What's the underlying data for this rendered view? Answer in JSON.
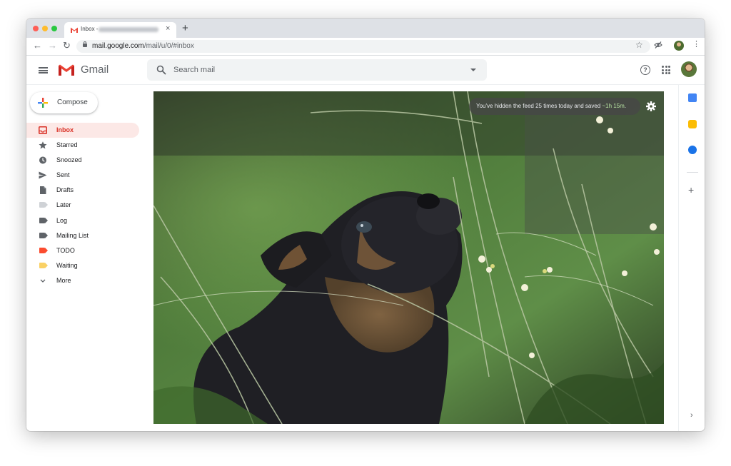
{
  "browser": {
    "tab_title": "Inbox -",
    "tab_close": "×",
    "new_tab": "+",
    "back": "←",
    "forward": "→",
    "reload": "↻",
    "url_domain": "mail.google.com",
    "url_path": "/mail/u/0/#inbox",
    "bookmark_star": "☆",
    "menu": "⋮"
  },
  "gmail": {
    "app_name": "Gmail",
    "search_placeholder": "Search mail",
    "help": "?",
    "compose_label": "Compose"
  },
  "sidebar": {
    "items": [
      {
        "label": "Inbox",
        "icon": "inbox-icon",
        "active": true
      },
      {
        "label": "Starred",
        "icon": "star-icon"
      },
      {
        "label": "Snoozed",
        "icon": "clock-icon"
      },
      {
        "label": "Sent",
        "icon": "send-icon"
      },
      {
        "label": "Drafts",
        "icon": "draft-icon"
      },
      {
        "label": "Later",
        "icon": "label-icon",
        "color": "#cfd2d6"
      },
      {
        "label": "Log",
        "icon": "label-icon",
        "color": "#5f6368"
      },
      {
        "label": "Mailing List",
        "icon": "label-icon",
        "color": "#5f6368"
      },
      {
        "label": "TODO",
        "icon": "label-icon",
        "color": "#fb4c2f"
      },
      {
        "label": "Waiting",
        "icon": "label-icon",
        "color": "#fad165"
      },
      {
        "label": "More",
        "icon": "chevron-down-icon"
      }
    ]
  },
  "feed_notice": {
    "text": "You've hidden the feed 25 times today and saved ",
    "time_saved": "~1h 15m",
    "end": "."
  },
  "right_rail": {
    "add": "+",
    "expand": "›"
  },
  "colors": {
    "accent_red": "#d93025",
    "active_bg": "#fce8e6",
    "calendar": "#4285f4",
    "keep": "#fbbc04",
    "tasks": "#1a73e8"
  }
}
